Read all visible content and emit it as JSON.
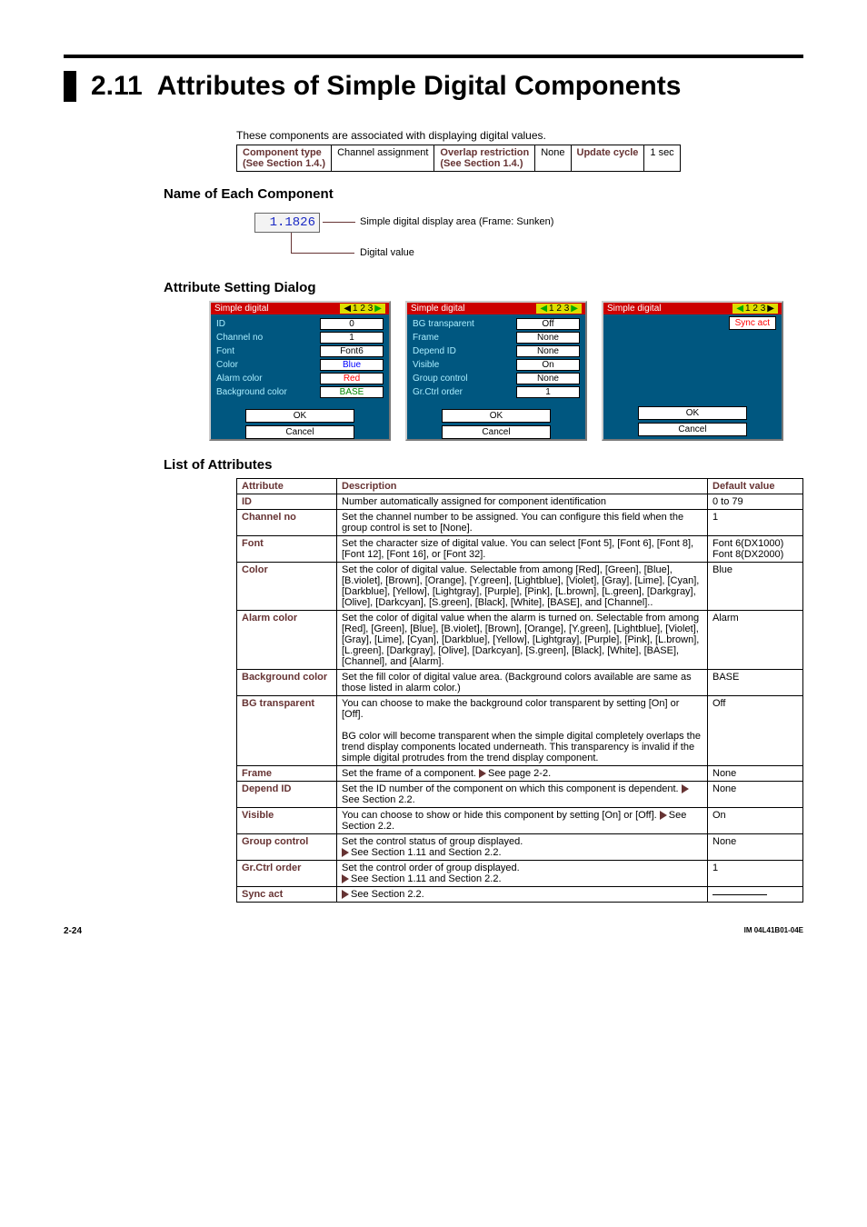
{
  "page": {
    "section_number": "2.11",
    "section_title": "Attributes of Simple Digital Components",
    "intro": "These components are associated with displaying digital values.",
    "page_number": "2-24",
    "doc_id": "IM 04L41B01-04E"
  },
  "comp_table": {
    "component_type_label": "Component type",
    "component_type_note": "(See Section 1.4.)",
    "component_type_value": "Channel assignment",
    "overlap_label": "Overlap restriction",
    "overlap_note": "(See Section 1.4.)",
    "overlap_value": "None",
    "update_label": "Update cycle",
    "update_value": "1 sec"
  },
  "sub_name_each": "Name of Each Component",
  "diagram": {
    "value": "1.1826",
    "label_top": "Simple digital display area (Frame: Sunken)",
    "label_bottom": "Digital value"
  },
  "sub_attr_dialog": "Attribute Setting Dialog",
  "dialogs": {
    "title": "Simple digital",
    "ok": "OK",
    "cancel": "Cancel",
    "d1": {
      "page": "1 2 3",
      "rows": [
        {
          "label": "ID",
          "value": "0"
        },
        {
          "label": "Channel no",
          "value": "1"
        },
        {
          "label": "Font",
          "value": "Font6"
        },
        {
          "label": "Color",
          "value": "Blue"
        },
        {
          "label": "Alarm color",
          "value": "Red"
        },
        {
          "label": "Background color",
          "value": "BASE"
        }
      ]
    },
    "d2": {
      "page": "1 2 3",
      "rows": [
        {
          "label": "BG transparent",
          "value": "Off"
        },
        {
          "label": "Frame",
          "value": "None"
        },
        {
          "label": "Depend ID",
          "value": "None"
        },
        {
          "label": "Visible",
          "value": "On"
        },
        {
          "label": "Group control",
          "value": "None"
        },
        {
          "label": "Gr.Ctrl order",
          "value": "1"
        }
      ]
    },
    "d3": {
      "page": "1 2 3",
      "sync": "Sync act"
    }
  },
  "sub_list_attrs": "List of Attributes",
  "attr_table": {
    "head": {
      "attribute": "Attribute",
      "description": "Description",
      "default": "Default value"
    },
    "rows": [
      {
        "attr": "ID",
        "desc": "Number automatically assigned for component identification",
        "def": "0 to 79"
      },
      {
        "attr": "Channel no",
        "desc": "Set the channel number to be assigned. You can configure this field when the group control is set to [None].",
        "def": "1"
      },
      {
        "attr": "Font",
        "desc": "Set the character size of digital value. You can select [Font 5], [Font 6], [Font 8], [Font 12], [Font 16], or [Font 32].",
        "def": "Font 6(DX1000)\nFont 8(DX2000)"
      },
      {
        "attr": "Color",
        "desc": "Set the color of digital value. Selectable from among [Red], [Green], [Blue], [B.violet], [Brown], [Orange], [Y.green], [Lightblue], [Violet], [Gray], [Lime], [Cyan], [Darkblue], [Yellow], [Lightgray], [Purple], [Pink], [L.brown], [L.green], [Darkgray], [Olive], [Darkcyan], [S.green], [Black], [White], [BASE], and [Channel]..",
        "def": "Blue"
      },
      {
        "attr": "Alarm color",
        "desc": "Set the color of digital value when the alarm is turned on. Selectable from among [Red], [Green], [Blue], [B.violet], [Brown], [Orange], [Y.green], [Lightblue], [Violet], [Gray], [Lime], [Cyan], [Darkblue], [Yellow], [Lightgray], [Purple], [Pink], [L.brown], [L.green], [Darkgray], [Olive], [Darkcyan], [S.green], [Black], [White], [BASE], [Channel], and [Alarm].",
        "def": "Alarm"
      },
      {
        "attr": "Background color",
        "desc": "Set the fill color of digital value area. (Background colors available are same as those listed in alarm color.)",
        "def": "BASE"
      },
      {
        "attr": "BG transparent",
        "desc": "You can choose to make the background color transparent by setting [On] or [Off].\nBG color will become transparent when the simple digital completely overlaps the trend display components located underneath. This transparency is invalid if the simple digital protrudes from the trend display component.",
        "def": "Off"
      },
      {
        "attr": "Frame",
        "desc": "Set the frame of a component. ▶See page 2-2.",
        "def": "None",
        "has_arrow": true,
        "arrow_after": "See page 2-2."
      },
      {
        "attr": "Depend ID",
        "desc": "Set the ID number of the component on which this component is dependent. ▶See Section 2.2.",
        "def": "None",
        "has_arrow": true,
        "arrow_after": "See Section 2.2."
      },
      {
        "attr": "Visible",
        "desc": "You can choose to show or hide this component by setting [On] or [Off]. ▶See Section 2.2.",
        "def": "On",
        "has_arrow": true,
        "arrow_after": "See Section 2.2."
      },
      {
        "attr": "Group control",
        "desc": "Set the control status of group displayed.\n▶See Section 1.11 and Section 2.2.",
        "def": "None",
        "has_arrow": true,
        "arrow_after": "See Section 1.11 and Section 2.2.",
        "preline": "Set the control status of group displayed."
      },
      {
        "attr": "Gr.Ctrl order",
        "desc": "Set the control order of group displayed.\n▶See Section 1.11 and Section 2.2.",
        "def": "1",
        "has_arrow": true,
        "arrow_after": "See Section 1.11 and Section 2.2.",
        "preline": "Set the control order of group displayed."
      },
      {
        "attr": "Sync act",
        "desc": "▶See Section 2.2.",
        "def": "__SYNC_LINE__",
        "has_arrow": true,
        "arrow_after": "See Section 2.2.",
        "only_arrow": true
      }
    ]
  }
}
